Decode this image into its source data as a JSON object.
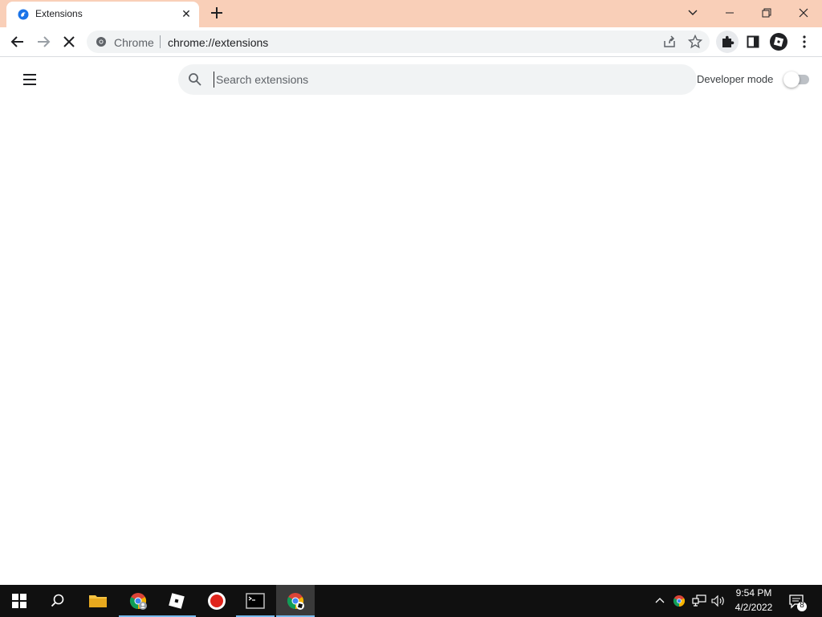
{
  "browser": {
    "tab": {
      "title": "Extensions",
      "close_glyph": "✕"
    },
    "omnibox": {
      "chip_label": "Chrome",
      "url": "chrome://extensions"
    },
    "icons": {
      "back": "arrow-left-icon",
      "forward": "arrow-right-icon",
      "reload": "stop-loading-icon",
      "share": "share-icon",
      "bookmark": "star-icon",
      "extensions": "puzzle-icon",
      "side_panel": "side-panel-icon",
      "profile": "roblox-profile-icon",
      "more": "kebab-menu-icon"
    },
    "colors": {
      "titlebar": "#f9cfb8",
      "omnibox": "#f1f3f4"
    }
  },
  "page": {
    "search": {
      "placeholder": "Search extensions",
      "value": ""
    },
    "developer_mode": {
      "label": "Developer mode",
      "enabled": false
    }
  },
  "taskbar": {
    "apps": [
      "windows-start",
      "search",
      "file-explorer",
      "chrome-profile",
      "roblox",
      "recorder",
      "terminal",
      "chrome"
    ],
    "clock": {
      "time": "9:54 PM",
      "date": "4/2/2022"
    },
    "notifications_count": "8"
  }
}
